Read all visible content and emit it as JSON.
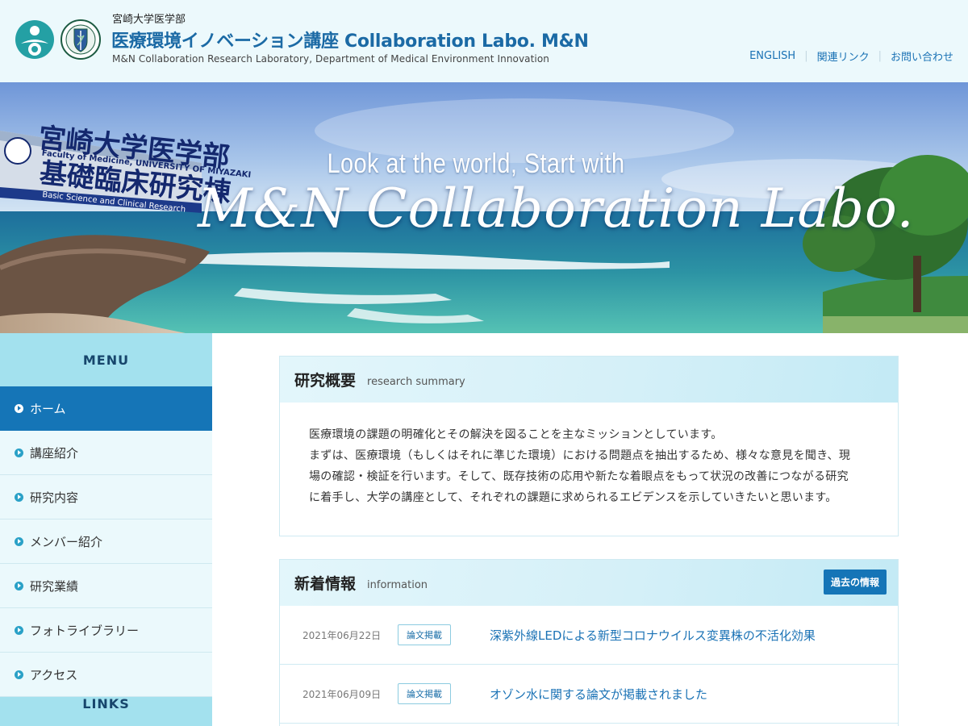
{
  "header": {
    "university": "宮崎大学医学部",
    "title": "医療環境イノベーション講座 Collaboration Labo. M&N",
    "subtitle": "M&N Collaboration Research Laboratory, Department of Medical Environment Innovation",
    "links": [
      "ENGLISH",
      "関連リンク",
      "お問い合わせ"
    ]
  },
  "hero": {
    "line1": "Look at the world, Start with",
    "line2": "M&N Collaboration Labo.",
    "building_sign": {
      "name": "宮崎大学医学部",
      "english": "Faculty of Medicine, UNIVERSITY OF MIYAZAKI",
      "building": "基礎臨床研究棟",
      "band": "Basic Science and Clinical Research"
    }
  },
  "sidebar": {
    "menu_title": "MENU",
    "items": [
      {
        "label": "ホーム",
        "active": true
      },
      {
        "label": "講座紹介",
        "active": false
      },
      {
        "label": "研究内容",
        "active": false
      },
      {
        "label": "メンバー紹介",
        "active": false
      },
      {
        "label": "研究業績",
        "active": false
      },
      {
        "label": "フォトライブラリー",
        "active": false
      },
      {
        "label": "アクセス",
        "active": false
      }
    ],
    "links_title": "LINKS"
  },
  "summary": {
    "title": "研究概要",
    "subtitle": "research summary",
    "lines": [
      "医療環境の課題の明確化とその解決を図ることを主なミッションとしています。",
      "まずは、医療環境（もしくはそれに準じた環境）における問題点を抽出するため、様々な意見を聞き、現",
      "場の確認・検証を行います。そして、既存技術の応用や新たな着眼点をもって状況の改善につながる研究",
      "に着手し、大学の講座として、それぞれの課題に求められるエビデンスを示していきたいと思います。"
    ]
  },
  "news": {
    "title": "新着情報",
    "subtitle": "information",
    "past_button": "過去の情報",
    "items": [
      {
        "date": "2021年06月22日",
        "tag": "論文掲載",
        "title": "深紫外線LEDによる新型コロナウイルス変異株の不活化効果"
      },
      {
        "date": "2021年06月09日",
        "tag": "論文掲載",
        "title": "オゾン水に関する論文が掲載されました"
      }
    ]
  },
  "colors": {
    "brand_blue": "#1575b7",
    "sidebar_bg": "#a3e1ee",
    "header_bg": "#ecf9fc",
    "link_blue": "#1a72b5"
  }
}
